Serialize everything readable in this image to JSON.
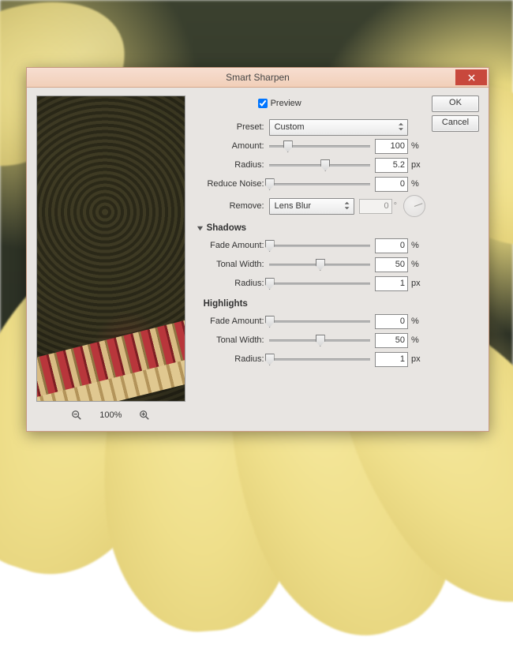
{
  "window": {
    "title": "Smart Sharpen"
  },
  "buttons": {
    "ok": "OK",
    "cancel": "Cancel",
    "close": "×"
  },
  "preview": {
    "label": "Preview",
    "checked": true,
    "zoom": "100%"
  },
  "preset": {
    "label": "Preset:",
    "value": "Custom"
  },
  "main": {
    "amount": {
      "label": "Amount:",
      "value": "100",
      "unit": "%",
      "pos": 18
    },
    "radius": {
      "label": "Radius:",
      "value": "5.2",
      "unit": "px",
      "pos": 55
    },
    "reduceNoise": {
      "label": "Reduce Noise:",
      "value": "0",
      "unit": "%",
      "pos": 0
    }
  },
  "remove": {
    "label": "Remove:",
    "value": "Lens Blur",
    "angle": "0"
  },
  "shadows": {
    "header": "Shadows",
    "fade": {
      "label": "Fade Amount:",
      "value": "0",
      "unit": "%",
      "pos": 0
    },
    "tonal": {
      "label": "Tonal Width:",
      "value": "50",
      "unit": "%",
      "pos": 50
    },
    "radius": {
      "label": "Radius:",
      "value": "1",
      "unit": "px",
      "pos": 0
    }
  },
  "highlights": {
    "header": "Highlights",
    "fade": {
      "label": "Fade Amount:",
      "value": "0",
      "unit": "%",
      "pos": 0
    },
    "tonal": {
      "label": "Tonal Width:",
      "value": "50",
      "unit": "%",
      "pos": 50
    },
    "radius": {
      "label": "Radius:",
      "value": "1",
      "unit": "px",
      "pos": 0
    }
  }
}
